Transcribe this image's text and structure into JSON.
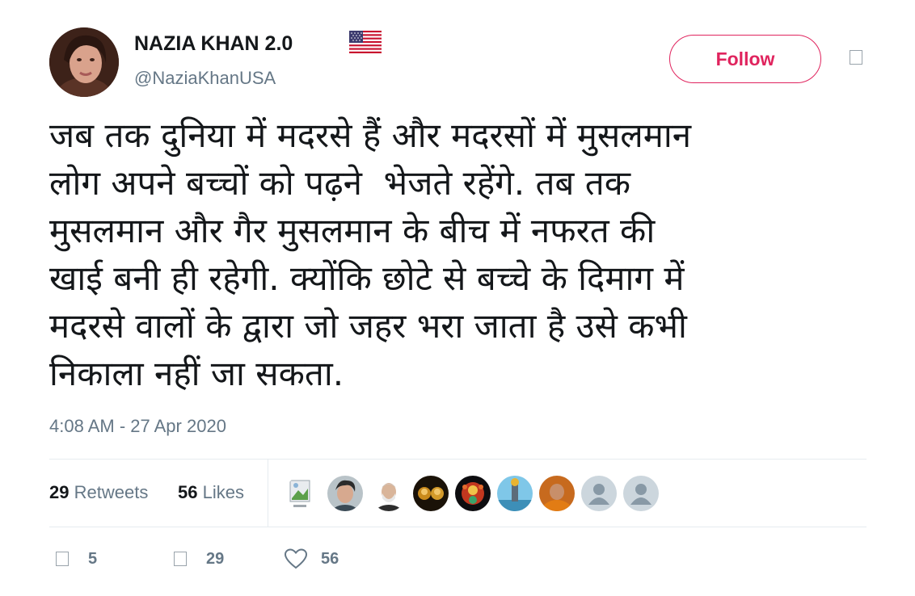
{
  "user": {
    "display_name": "NAZIA KHAN 2.0",
    "handle": "@NaziaKhanUSA",
    "flag_icon": "us-flag-icon"
  },
  "follow_label": "Follow",
  "tweet": {
    "text": "जब तक दुनिया में मदरसे हैं और मदरसों में मुसलमान\nलोग अपने बच्चों को पढ़ने  भेजते रहेंगे. तब तक\nमुसलमान और गैर मुसलमान के बीच में नफरत की\nखाई बनी ही रहेगी. क्योंकि छोटे से बच्चे के दिमाग में\nमदरसे वालों के द्वारा जो जहर भरा जाता है उसे कभी\nनिकाला नहीं जा सकता.",
    "timestamp": "4:08 AM - 27 Apr 2020"
  },
  "stats": {
    "retweets_count": "29",
    "retweets_label": "Retweets",
    "likes_count": "56",
    "likes_label": "Likes"
  },
  "actions": {
    "reply_count": "5",
    "retweet_count": "29",
    "like_count": "56"
  },
  "colors": {
    "accent": "#e0245e",
    "secondary_text": "#657786",
    "divider": "#e6ecf0"
  }
}
